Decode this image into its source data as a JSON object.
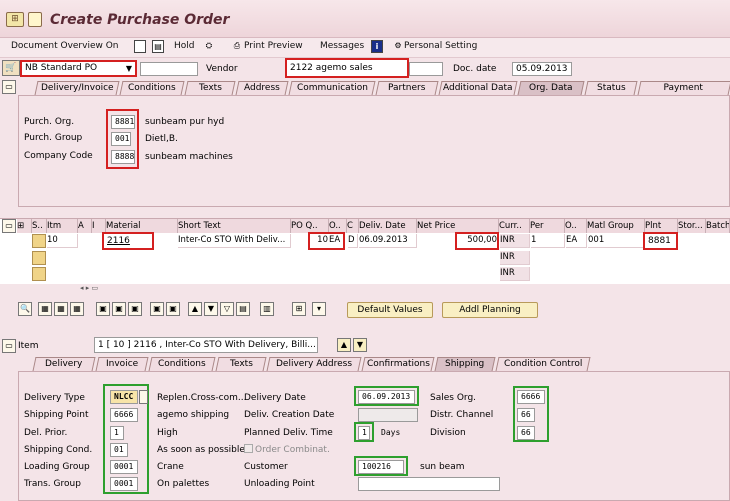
{
  "title": "Create Purchase Order",
  "toolbar": {
    "doc_overview": "Document Overview On",
    "hold": "Hold",
    "print_preview": "Print Preview",
    "messages": "Messages",
    "personal_setting": "Personal Setting"
  },
  "header": {
    "doc_type": "NB Standard PO",
    "vendor_label": "Vendor",
    "vendor": "2122 agemo sales",
    "doc_date_label": "Doc. date",
    "doc_date": "05.09.2013"
  },
  "header_tabs": [
    "Delivery/Invoice",
    "Conditions",
    "Texts",
    "Address",
    "Communication",
    "Partners",
    "Additional Data",
    "Org. Data",
    "Status",
    "Payment Processing"
  ],
  "org": {
    "purch_org_label": "Purch. Org.",
    "purch_org": "8881",
    "purch_org_desc": "sunbeam pur hyd",
    "purch_group_label": "Purch. Group",
    "purch_group": "001",
    "purch_group_desc": "Dietl,B.",
    "company_code_label": "Company Code",
    "company_code": "8888",
    "company_code_desc": "sunbeam machines"
  },
  "grid": {
    "headers": [
      "S..",
      "Itm",
      "A",
      "I",
      "Material",
      "Short Text",
      "PO Q..",
      "O..",
      "C",
      "Deliv. Date",
      "Net Price",
      "Curr..",
      "Per",
      "O..",
      "Matl Group",
      "Plnt",
      "Stor...",
      "Batch"
    ],
    "row1": {
      "itm": "10",
      "material": "2116",
      "short_text": "Inter-Co STO With Deliv...",
      "qty": "10",
      "unit": "EA",
      "cat": "D",
      "deliv_date": "06.09.2013",
      "net_price": "500,00",
      "curr": "INR",
      "per": "1",
      "order_unit": "EA",
      "matl_group": "001",
      "plant": "8881"
    },
    "curr2": "INR",
    "curr3": "INR"
  },
  "buttons": {
    "default_values": "Default Values",
    "addl_planning": "Addl Planning"
  },
  "item": {
    "label": "Item",
    "value": "1 [ 10 ] 2116 , Inter-Co STO With Delivery, Billi..."
  },
  "item_tabs": [
    "Delivery",
    "Invoice",
    "Conditions",
    "Texts",
    "Delivery Address",
    "Confirmations",
    "Shipping",
    "Condition Control"
  ],
  "shipping": {
    "delivery_type_label": "Delivery Type",
    "delivery_type": "NLCC",
    "shipping_point_label": "Shipping Point",
    "shipping_point": "6666",
    "del_prior_label": "Del. Prior.",
    "del_prior": "1",
    "shipping_cond_label": "Shipping Cond.",
    "shipping_cond": "01",
    "loading_group_label": "Loading Group",
    "loading_group": "0001",
    "trans_group_label": "Trans. Group",
    "trans_group": "0001",
    "replen_label": "Replen.Cross-com...",
    "agemo_shipping": "agemo shipping",
    "high": "High",
    "as_soon": "As soon as possible",
    "crane": "Crane",
    "on_palettes": "On palettes",
    "delivery_date_label": "Delivery Date",
    "delivery_date": "06.09.2013",
    "deliv_creation_label": "Deliv. Creation Date",
    "planned_deliv_label": "Planned Deliv. Time",
    "planned_deliv": "1",
    "days": "Days",
    "order_combinat": "Order Combinat.",
    "customer_label": "Customer",
    "customer": "100216",
    "customer_desc": "sun beam",
    "unloading_point_label": "Unloading Point",
    "sales_org_label": "Sales Org.",
    "sales_org": "6666",
    "distr_channel_label": "Distr. Channel",
    "distr_channel": "66",
    "division_label": "Division",
    "division": "66"
  }
}
